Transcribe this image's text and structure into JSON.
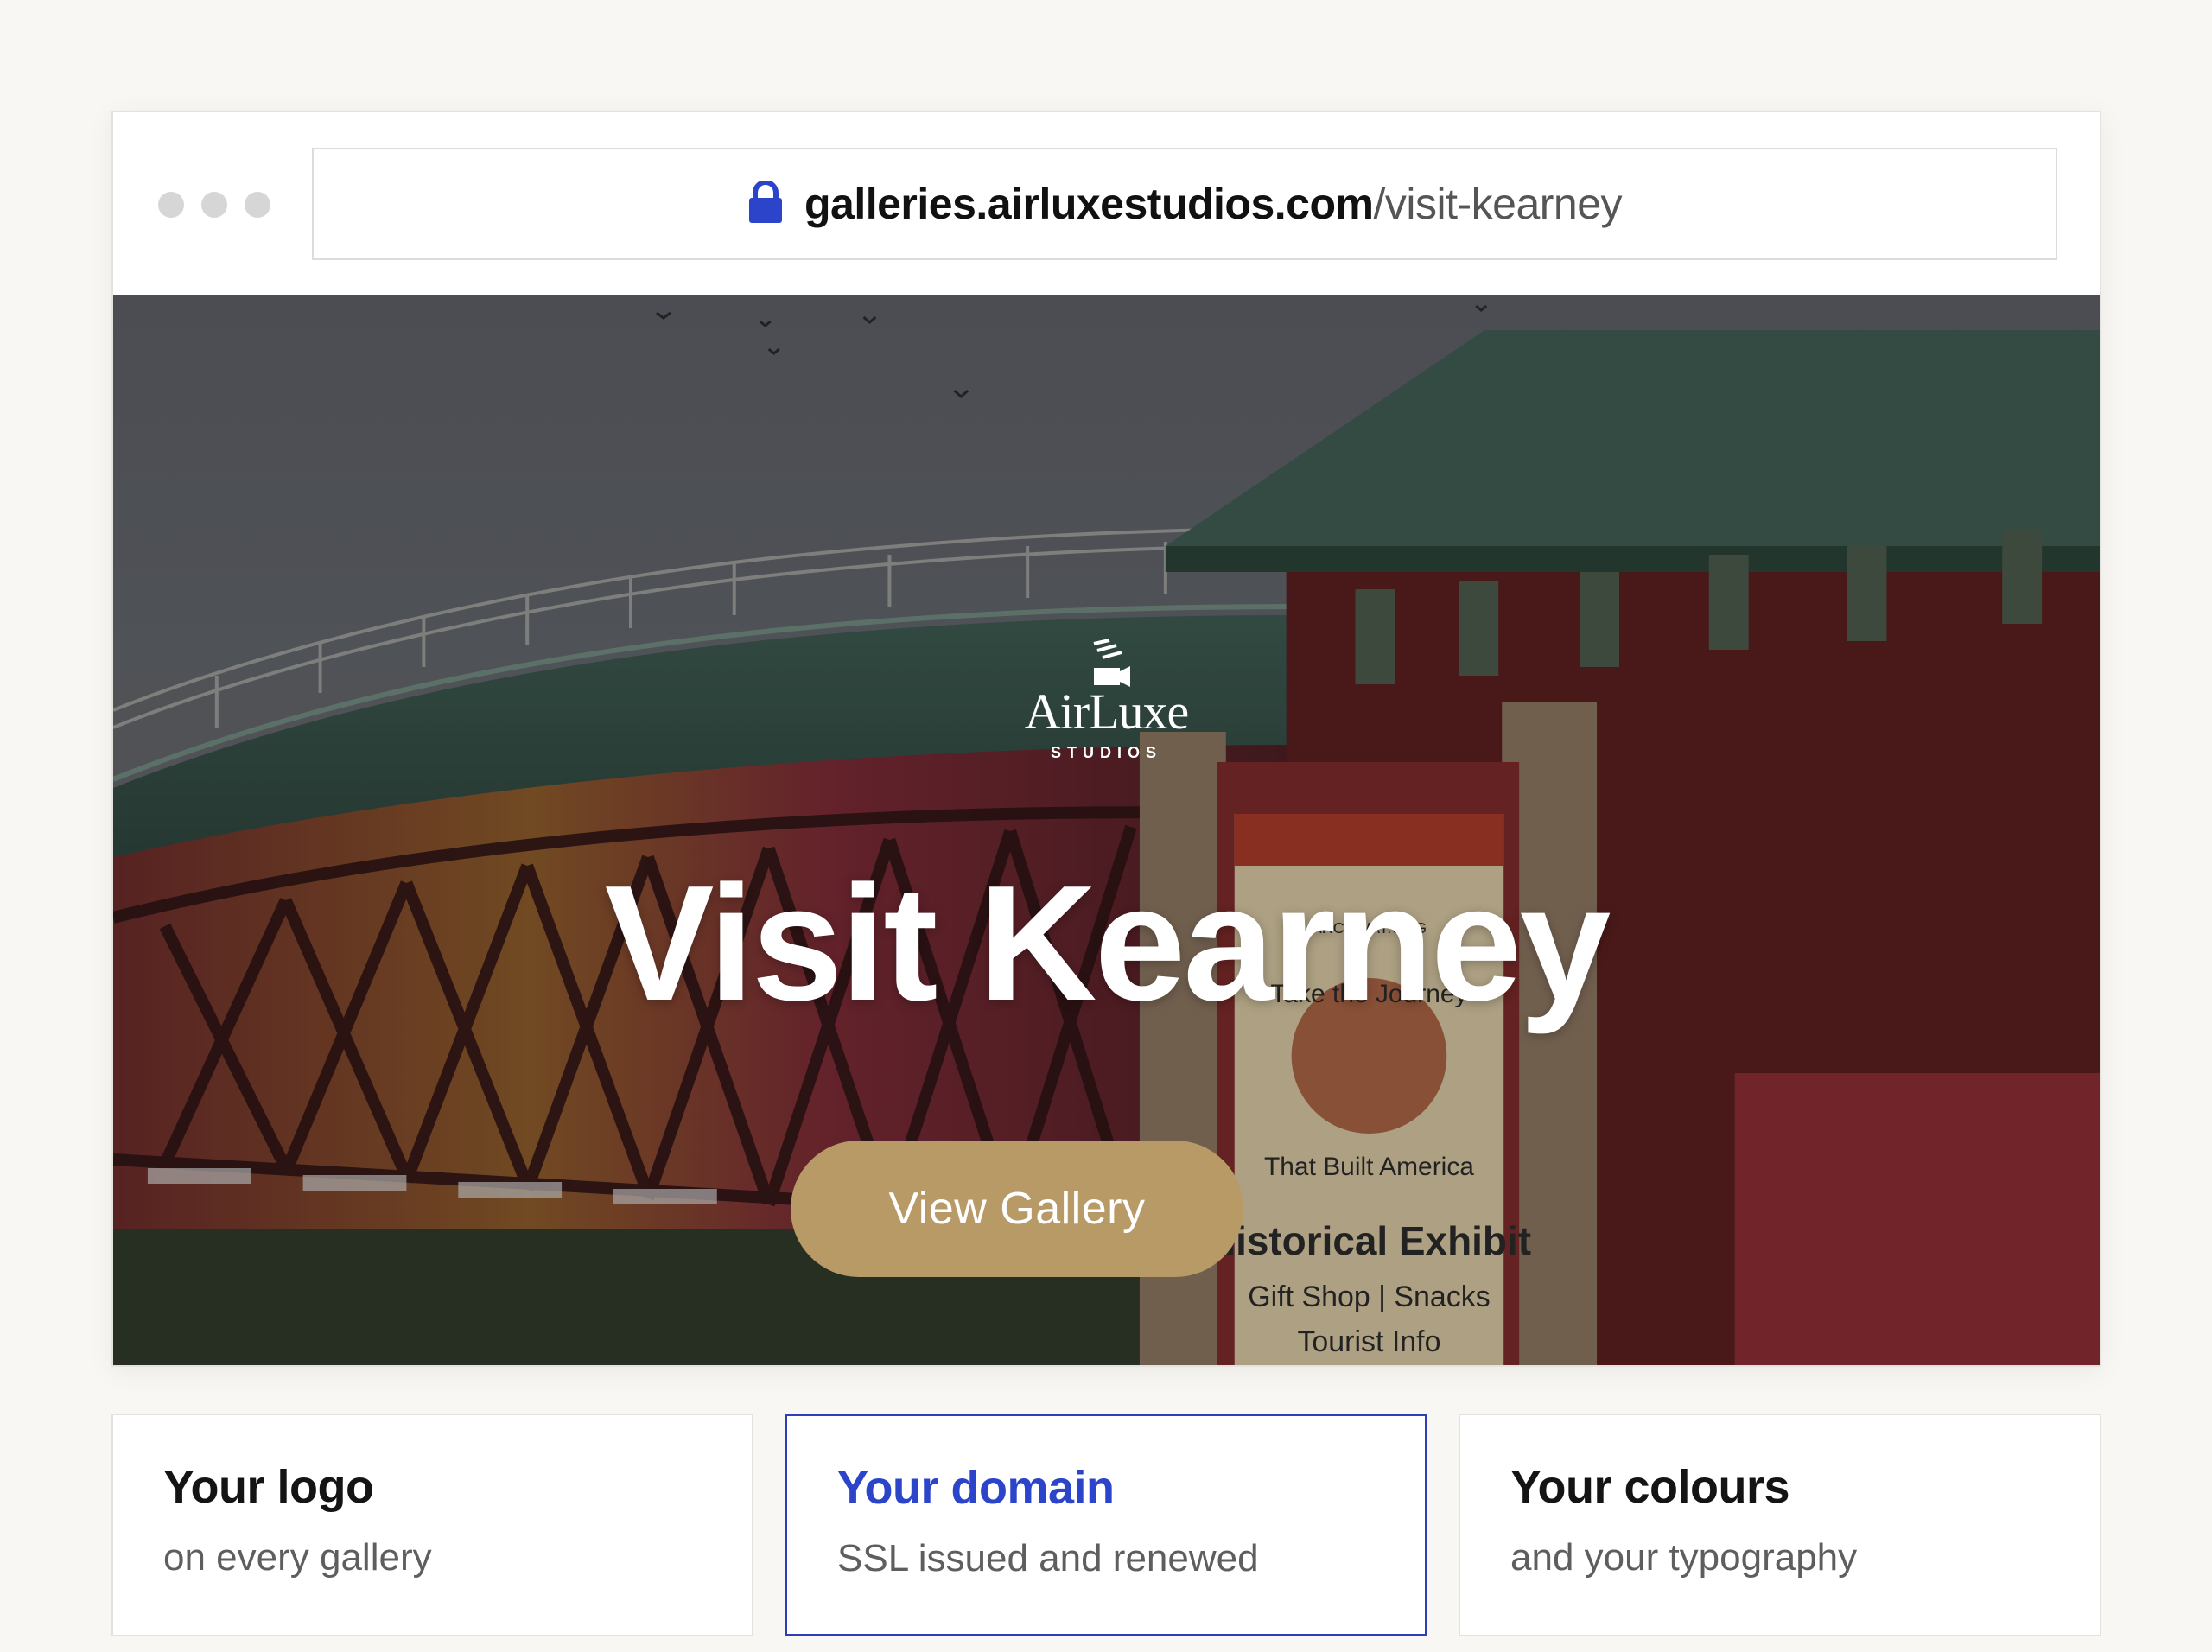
{
  "browser": {
    "url_host": "galleries.airluxestudios.com",
    "url_path": "/visit-kearney"
  },
  "hero": {
    "brand_name": "AirLuxe",
    "brand_sub": "STUDIOS",
    "title": "Visit Kearney",
    "cta_label": "View Gallery",
    "sign_lines": [
      "ARCHWAY.ORG",
      "Take the Journey",
      "That Built America",
      "Historical Exhibit",
      "Gift Shop | Snacks",
      "Tourist Info"
    ]
  },
  "features": [
    {
      "title": "Your logo",
      "subtitle": "on every gallery"
    },
    {
      "title": "Your domain",
      "subtitle": "SSL issued and renewed"
    },
    {
      "title": "Your colours",
      "subtitle": "and your typography"
    }
  ],
  "colors": {
    "accent": "#2b44c9",
    "cta": "#b79a66",
    "page_bg": "#f8f7f3"
  }
}
